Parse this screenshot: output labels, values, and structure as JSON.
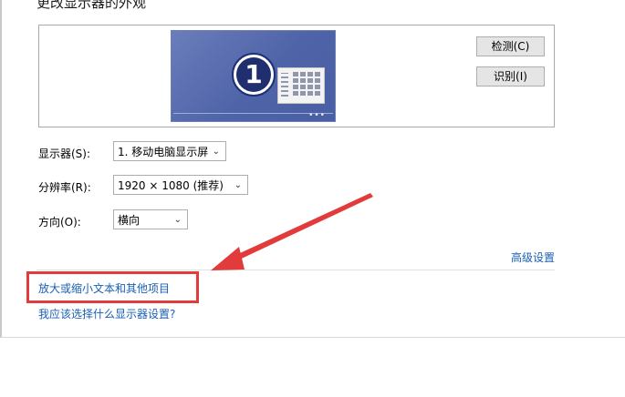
{
  "page": {
    "title": "更改显示器的外观"
  },
  "preview": {
    "monitor_number": "1",
    "dots": "•••",
    "detect_label": "检测(C)",
    "identify_label": "识别(I)"
  },
  "settings": {
    "display_label": "显示器(S):",
    "display_value": "1. 移动电脑显示屏",
    "resolution_label": "分辨率(R):",
    "resolution_value": "1920 × 1080 (推荐)",
    "orientation_label": "方向(O):",
    "orientation_value": "横向",
    "advanced_label": "高级设置"
  },
  "links": {
    "enlarge_text": "放大或缩小文本和其他项目",
    "which_settings": "我应该选择什么显示器设置?"
  },
  "colors": {
    "accent": "#1a5fb4",
    "highlight": "#e23b3b",
    "monitor": "#5468ad"
  },
  "icons": [
    "chevron-down-icon",
    "arrow-icon",
    "screen-icon"
  ]
}
